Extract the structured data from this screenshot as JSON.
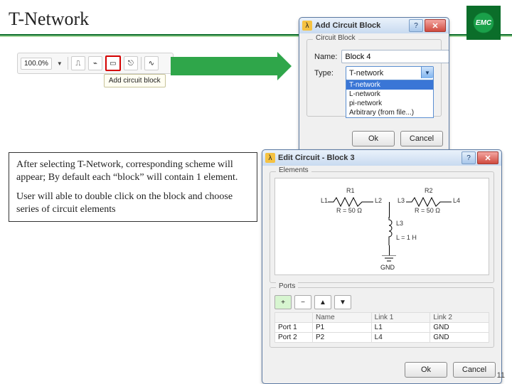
{
  "page_number": "11",
  "title": "T-Network",
  "logo_text": "EMC",
  "toolbar": {
    "zoom_value": "100.0%",
    "tooltip": "Add circuit block"
  },
  "info": {
    "p1": "After selecting T-Network, corresponding scheme will appear; By default each “block” will contain 1 element.",
    "p2": "User will able to double click on the block and choose series of circuit elements"
  },
  "add_dlg": {
    "title": "Add Circuit Block",
    "group_label": "Circuit Block",
    "name_label": "Name:",
    "name_value": "Block 4",
    "type_label": "Type:",
    "type_value": "T-network",
    "type_options": [
      "T-network",
      "L-network",
      "pi-network",
      "Arbitrary (from file...)"
    ],
    "ok": "Ok",
    "cancel": "Cancel"
  },
  "edit_dlg": {
    "title": "Edit Circuit - Block 3",
    "elements_group": "Elements",
    "ports_group": "Ports",
    "components": {
      "r1": {
        "label": "R1",
        "value": "R = 50 Ω",
        "l1": "L1",
        "l2": "L2"
      },
      "r2": {
        "label": "R2",
        "value": "R = 50 Ω",
        "l1": "L3",
        "l2": "L4"
      },
      "ind": {
        "label": "L3",
        "value": "L = 1 H"
      },
      "gnd": "GND"
    },
    "ports_buttons": {
      "add": "+",
      "del": "−",
      "up": "▲",
      "down": "▼"
    },
    "ports_headers": {
      "col1": "Name",
      "col2": "Link 1",
      "col3": "Link 2"
    },
    "ports_rows": [
      {
        "idx": "Port 1",
        "name": "P1",
        "l1": "L1",
        "l2": "GND"
      },
      {
        "idx": "Port 2",
        "name": "P2",
        "l1": "L4",
        "l2": "GND"
      }
    ],
    "ok": "Ok",
    "cancel": "Cancel"
  }
}
